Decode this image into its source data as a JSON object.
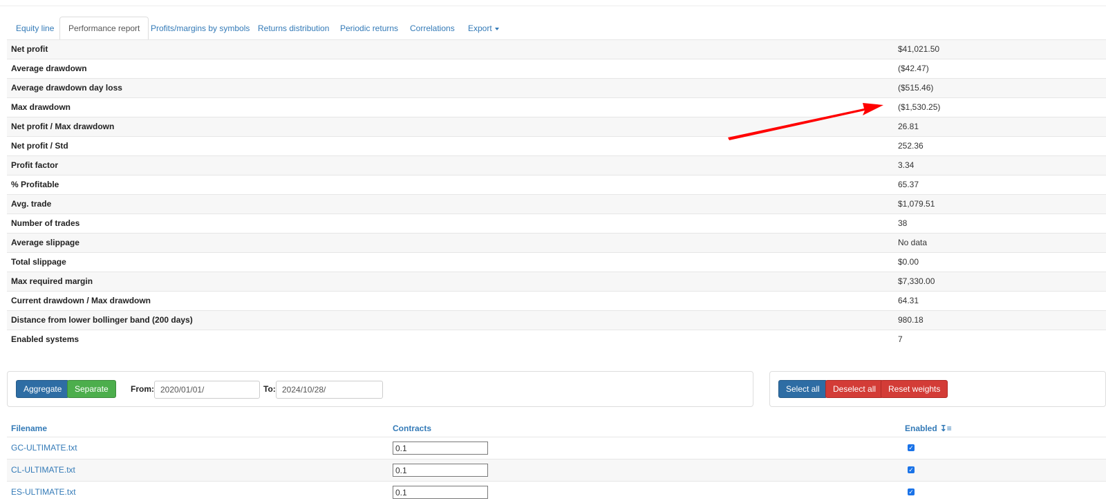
{
  "tabs": [
    {
      "label": "Equity line",
      "active": false
    },
    {
      "label": "Performance report",
      "active": true
    },
    {
      "label": "Profits/margins by symbols",
      "active": false
    },
    {
      "label": "Returns distribution",
      "active": false
    },
    {
      "label": "Periodic returns",
      "active": false
    },
    {
      "label": "Correlations",
      "active": false
    },
    {
      "label": "Export",
      "active": false
    }
  ],
  "stats": [
    {
      "label": "Net profit",
      "value": "$41,021.50"
    },
    {
      "label": "Average drawdown",
      "value": "($42.47)"
    },
    {
      "label": "Average drawdown day loss",
      "value": "($515.46)"
    },
    {
      "label": "Max drawdown",
      "value": "($1,530.25)"
    },
    {
      "label": "Net profit / Max drawdown",
      "value": "26.81"
    },
    {
      "label": "Net profit / Std",
      "value": "252.36"
    },
    {
      "label": "Profit factor",
      "value": "3.34"
    },
    {
      "label": "% Profitable",
      "value": "65.37"
    },
    {
      "label": "Avg. trade",
      "value": "$1,079.51"
    },
    {
      "label": "Number of trades",
      "value": "38"
    },
    {
      "label": "Average slippage",
      "value": "No data"
    },
    {
      "label": "Total slippage",
      "value": "$0.00"
    },
    {
      "label": "Max required margin",
      "value": "$7,330.00"
    },
    {
      "label": "Current drawdown / Max drawdown",
      "value": "64.31"
    },
    {
      "label": "Distance from lower bollinger band (200 days)",
      "value": "980.18"
    },
    {
      "label": "Enabled systems",
      "value": "7"
    }
  ],
  "controls": {
    "aggregate_label": "Aggregate",
    "separate_label": "Separate",
    "from_label": "From:",
    "from_value": "2020/01/01/",
    "to_label": "To:",
    "to_value": "2024/10/28/",
    "select_all_label": "Select all",
    "deselect_all_label": "Deselect all",
    "reset_weights_label": "Reset weights"
  },
  "files_table": {
    "headers": {
      "filename": "Filename",
      "contracts": "Contracts",
      "enabled": "Enabled"
    },
    "rows": [
      {
        "filename": "GC-ULTIMATE.txt",
        "contracts": "0.1",
        "enabled": true
      },
      {
        "filename": "CL-ULTIMATE.txt",
        "contracts": "0.1",
        "enabled": true
      },
      {
        "filename": "ES-ULTIMATE.txt",
        "contracts": "0.1",
        "enabled": true
      }
    ]
  },
  "annotation": {
    "arrow_color": "#ff0000"
  },
  "colors": {
    "link": "#337ab7",
    "primary": "#2e6da4",
    "success": "#4cae4c",
    "danger": "#d33c37"
  }
}
